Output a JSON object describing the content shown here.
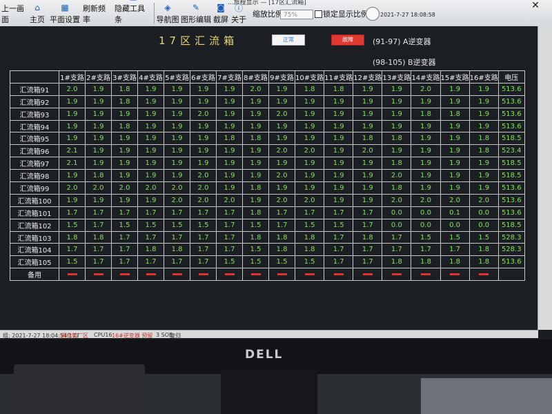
{
  "window": {
    "title": "...旅程显示 — [17区汇流箱]"
  },
  "toolbar": {
    "items": [
      {
        "label": "上一画面",
        "icon": "back-arrow-icon"
      },
      {
        "label": "主页",
        "icon": "home-icon"
      },
      {
        "label": "平面设置",
        "icon": "layout-icon"
      },
      {
        "label": "刷新频率",
        "icon": "refresh-icon"
      },
      {
        "label": "隐藏工具条",
        "icon": "hide-toolbar-icon"
      },
      {
        "label": "导航图",
        "icon": "navigation-map-icon"
      },
      {
        "label": "图形编辑",
        "icon": "graphic-edit-icon"
      },
      {
        "label": "截屏",
        "icon": "camera-icon"
      },
      {
        "label": "关于",
        "icon": "info-icon"
      }
    ],
    "zoom_label": "缩放比例",
    "zoom_value": "75%",
    "lock_label": "锁定显示比例",
    "datetime": "2021-7-27 18:08:58"
  },
  "page": {
    "title": "17区汇流箱",
    "legend_normal": "正常",
    "legend_fault": "故障",
    "note_a": "(91-97)  A逆变器",
    "note_b": "(98-105)  B逆变器"
  },
  "table": {
    "headers": [
      "1#支路",
      "2#支路",
      "3#支路",
      "4#支路",
      "5#支路",
      "6#支路",
      "7#支路",
      "8#支路",
      "9#支路",
      "10#支路",
      "11#支路",
      "12#支路",
      "13#支路",
      "14#支路",
      "15#支路",
      "16#支路",
      "电压"
    ],
    "rows": [
      {
        "name": "汇流箱91",
        "values": [
          "2.0",
          "1.9",
          "1.8",
          "1.9",
          "1.9",
          "1.9",
          "1.9",
          "2.0",
          "1.9",
          "1.8",
          "1.8",
          "1.9",
          "1.9",
          "2.0",
          "1.9",
          "1.9",
          "513.6"
        ]
      },
      {
        "name": "汇流箱92",
        "values": [
          "1.9",
          "1.9",
          "1.8",
          "1.9",
          "1.9",
          "1.9",
          "1.9",
          "1.9",
          "1.9",
          "1.9",
          "1.9",
          "1.9",
          "1.9",
          "1.9",
          "1.9",
          "1.9",
          "513.6"
        ]
      },
      {
        "name": "汇流箱93",
        "values": [
          "1.9",
          "1.9",
          "1.9",
          "1.9",
          "1.9",
          "2.0",
          "1.9",
          "1.9",
          "2.0",
          "1.9",
          "1.9",
          "1.9",
          "1.9",
          "1.8",
          "1.8",
          "1.9",
          "513.6"
        ]
      },
      {
        "name": "汇流箱94",
        "values": [
          "1.9",
          "1.9",
          "1.8",
          "1.9",
          "1.9",
          "1.9",
          "1.9",
          "1.9",
          "1.9",
          "1.9",
          "1.9",
          "1.9",
          "1.9",
          "1.9",
          "1.9",
          "1.9",
          "513.6"
        ]
      },
      {
        "name": "汇流箱95",
        "values": [
          "1.9",
          "1.9",
          "1.9",
          "1.9",
          "1.9",
          "1.9",
          "1.8",
          "1.8",
          "1.9",
          "1.9",
          "1.9",
          "1.8",
          "1.8",
          "1.9",
          "1.9",
          "1.8",
          "518.5"
        ]
      },
      {
        "name": "汇流箱96",
        "values": [
          "2.1",
          "1.9",
          "1.9",
          "1.9",
          "1.9",
          "1.9",
          "1.9",
          "1.9",
          "2.0",
          "2.0",
          "1.9",
          "2.0",
          "1.9",
          "1.9",
          "1.9",
          "1.8",
          "523.4"
        ]
      },
      {
        "name": "汇流箱97",
        "values": [
          "2.1",
          "1.9",
          "1.9",
          "1.9",
          "1.9",
          "1.9",
          "1.9",
          "1.9",
          "1.9",
          "1.9",
          "1.9",
          "1.9",
          "1.8",
          "1.9",
          "1.9",
          "1.9",
          "518.5"
        ]
      },
      {
        "name": "汇流箱98",
        "values": [
          "1.9",
          "1.8",
          "1.9",
          "1.9",
          "1.9",
          "2.0",
          "1.9",
          "1.9",
          "2.0",
          "1.9",
          "1.9",
          "1.9",
          "2.0",
          "1.9",
          "1.9",
          "1.9",
          "518.5"
        ]
      },
      {
        "name": "汇流箱99",
        "values": [
          "2.0",
          "2.0",
          "2.0",
          "2.0",
          "2.0",
          "2.0",
          "1.9",
          "1.8",
          "1.9",
          "1.9",
          "1.9",
          "1.9",
          "1.8",
          "1.9",
          "1.9",
          "1.9",
          "513.6"
        ]
      },
      {
        "name": "汇流箱100",
        "values": [
          "1.9",
          "1.9",
          "1.9",
          "1.9",
          "2.0",
          "2.0",
          "2.0",
          "1.9",
          "2.0",
          "2.0",
          "1.9",
          "1.9",
          "2.0",
          "2.0",
          "2.0",
          "2.0",
          "513.6"
        ]
      },
      {
        "name": "汇流箱101",
        "values": [
          "1.7",
          "1.7",
          "1.7",
          "1.7",
          "1.7",
          "1.7",
          "1.7",
          "1.8",
          "1.7",
          "1.7",
          "1.7",
          "1.7",
          "0.0",
          "0.0",
          "0.1",
          "0.0",
          "513.6"
        ]
      },
      {
        "name": "汇流箱102",
        "values": [
          "1.5",
          "1.7",
          "1.5",
          "1.5",
          "1.5",
          "1.5",
          "1.7",
          "1.5",
          "1.7",
          "1.5",
          "1.5",
          "1.7",
          "0.0",
          "0.0",
          "0.0",
          "0.0",
          "518.5"
        ]
      },
      {
        "name": "汇流箱103",
        "values": [
          "1.8",
          "1.8",
          "1.7",
          "1.7",
          "1.7",
          "1.7",
          "1.7",
          "1.8",
          "1.8",
          "1.8",
          "1.7",
          "1.8",
          "1.7",
          "1.5",
          "1.5",
          "1.5",
          "528.3"
        ]
      },
      {
        "name": "汇流箱104",
        "values": [
          "1.7",
          "1.7",
          "1.7",
          "1.8",
          "1.8",
          "1.7",
          "1.7",
          "1.5",
          "1.8",
          "1.8",
          "1.7",
          "1.7",
          "1.7",
          "1.7",
          "1.7",
          "1.8",
          "528.3"
        ]
      },
      {
        "name": "汇流箱105",
        "values": [
          "1.5",
          "1.7",
          "1.7",
          "1.7",
          "1.7",
          "1.7",
          "1.5",
          "1.5",
          "1.5",
          "1.5",
          "1.7",
          "1.7",
          "1.8",
          "1.8",
          "1.8",
          "1.8",
          "513.6"
        ]
      }
    ],
    "spare_label": "备用",
    "spare_count": 16
  },
  "statusbar": {
    "left": "组: 2021-7-27 18:04:54 177",
    "plant": "新奇菊厂区",
    "cpu": "CPU16",
    "inverter": "16#逆变器 预留",
    "soe": "3 SOE",
    "reset": "复归"
  },
  "monitor": {
    "brand": "DELL"
  },
  "colors": {
    "value_green": "#86e35a",
    "title_yellow": "#e8d774",
    "spare_red": "#e2332a"
  }
}
